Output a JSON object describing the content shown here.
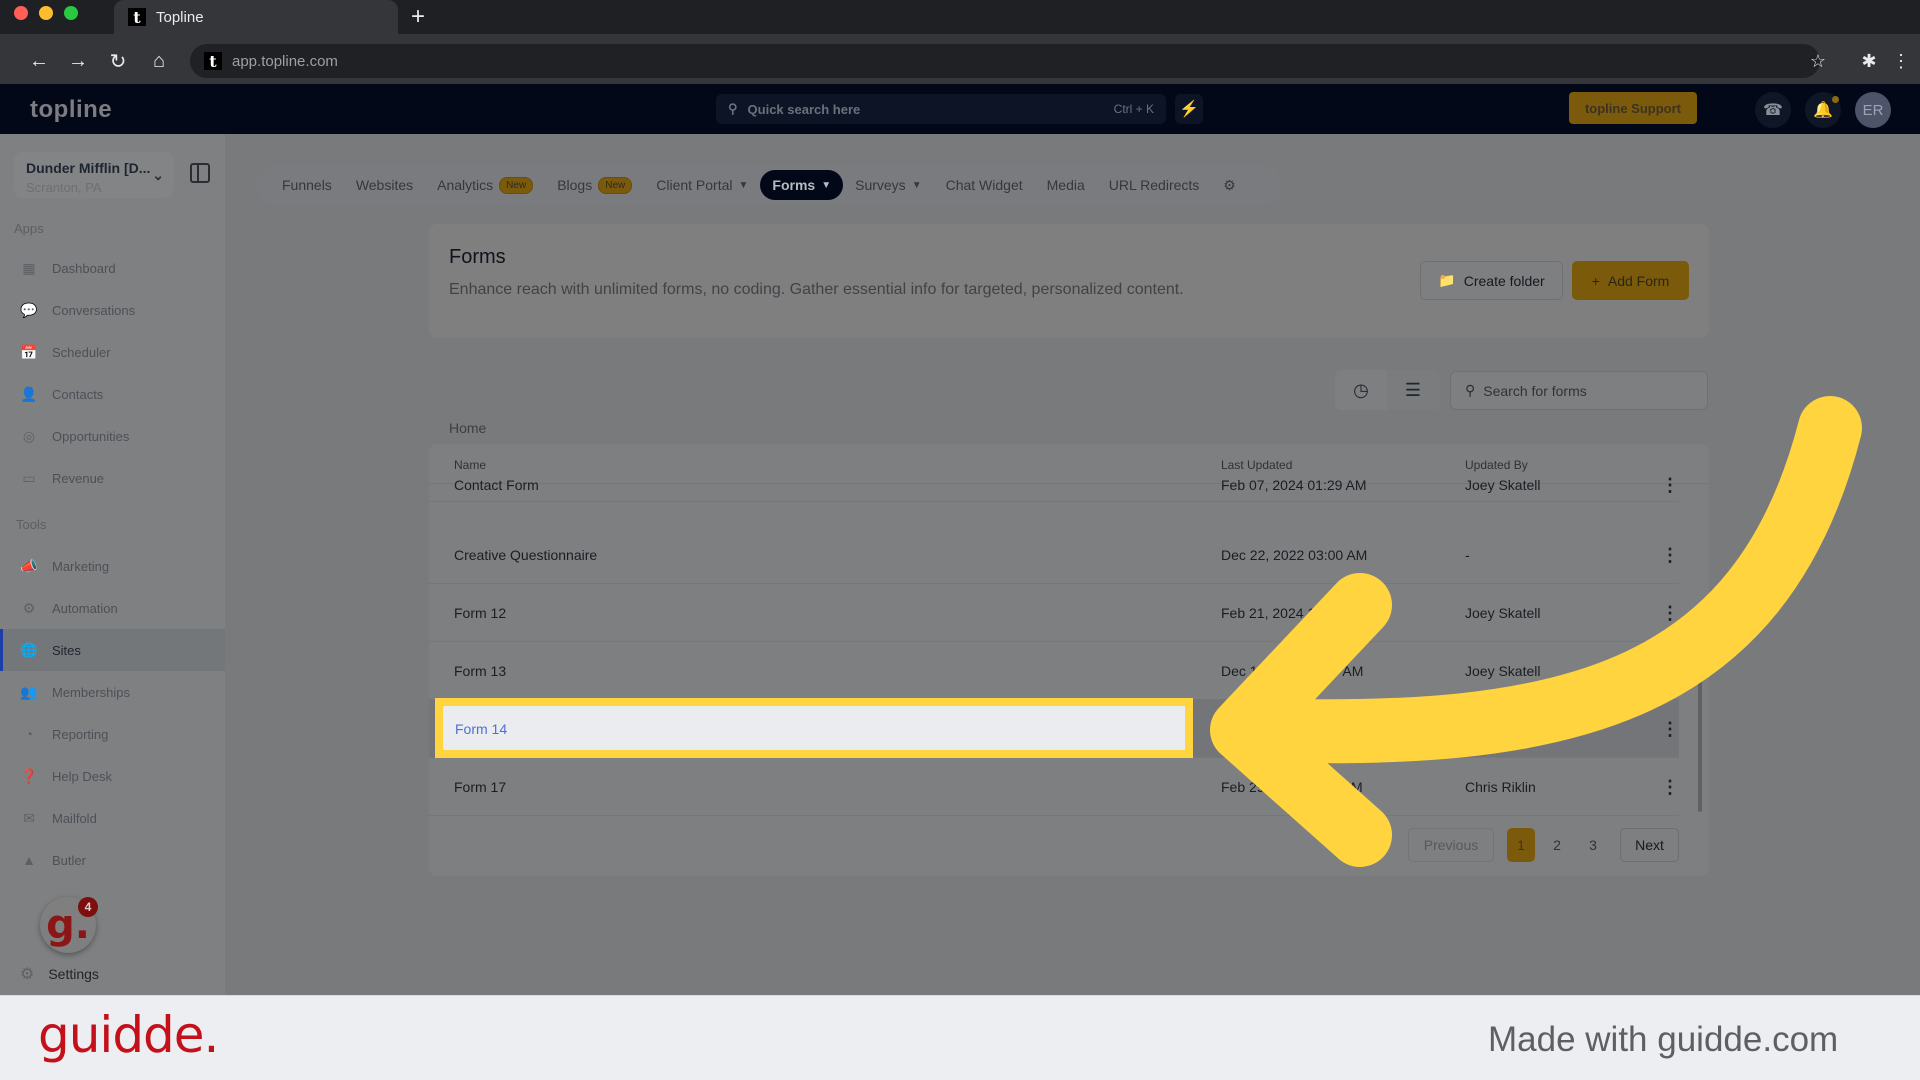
{
  "browser": {
    "tab_title": "Topline",
    "favicon_letter": "t",
    "url": "app.topline.com",
    "icons": [
      "back-icon",
      "forward-icon",
      "reload-icon",
      "home-icon",
      "star-icon",
      "extensions-icon",
      "menu-icon"
    ]
  },
  "header": {
    "logo": "topline",
    "quick_search_placeholder": "Quick search here",
    "quick_search_shortcut": "Ctrl + K",
    "support_label": "topline Support",
    "avatar_initials": "ER"
  },
  "sidebar": {
    "location_name": "Dunder Mifflin [D...",
    "location_sub": "Scranton, PA",
    "apps_heading": "Apps",
    "tools_heading": "Tools",
    "apps": [
      {
        "label": "Dashboard",
        "icon": "dashboard-icon"
      },
      {
        "label": "Conversations",
        "icon": "conversations-icon"
      },
      {
        "label": "Scheduler",
        "icon": "calendar-icon"
      },
      {
        "label": "Contacts",
        "icon": "contacts-icon"
      },
      {
        "label": "Opportunities",
        "icon": "opportunities-icon"
      },
      {
        "label": "Revenue",
        "icon": "revenue-icon"
      }
    ],
    "tools": [
      {
        "label": "Marketing",
        "icon": "megaphone-icon"
      },
      {
        "label": "Automation",
        "icon": "gears-icon"
      },
      {
        "label": "Sites",
        "icon": "globe-icon",
        "active": true
      },
      {
        "label": "Memberships",
        "icon": "memberships-icon"
      },
      {
        "label": "Reporting",
        "icon": "pie-chart-icon"
      },
      {
        "label": "Help Desk",
        "icon": "help-icon"
      },
      {
        "label": "Mailfold",
        "icon": "mailfold-icon"
      },
      {
        "label": "Butler",
        "icon": "bell-cloche-icon"
      }
    ],
    "guidde_badge_count": "4",
    "settings_label": "Settings"
  },
  "navtabs": [
    {
      "label": "Funnels"
    },
    {
      "label": "Websites"
    },
    {
      "label": "Analytics",
      "badge": "New"
    },
    {
      "label": "Blogs",
      "badge": "New"
    },
    {
      "label": "Client Portal",
      "dropdown": true
    },
    {
      "label": "Forms",
      "dropdown": true,
      "active": true
    },
    {
      "label": "Surveys",
      "dropdown": true
    },
    {
      "label": "Chat Widget"
    },
    {
      "label": "Media"
    },
    {
      "label": "URL Redirects"
    }
  ],
  "forms": {
    "title": "Forms",
    "description": "Enhance reach with unlimited forms, no coding. Gather essential info for targeted, personalized content.",
    "create_folder_label": "Create folder",
    "add_form_label": "Add Form",
    "search_placeholder": "Search for forms",
    "breadcrumb": "Home",
    "columns": [
      "Name",
      "Last Updated",
      "Updated By"
    ],
    "rows": [
      {
        "name": "Contact Form",
        "updated": "Feb 07, 2024 01:29 AM",
        "by": "Joey Skatell"
      },
      {
        "name": "Creative Questionnaire",
        "updated": "Dec 22, 2022 03:00 AM",
        "by": "-"
      },
      {
        "name": "Form 12",
        "updated": "Feb 21, 2024 1",
        "by": "Joey Skatell"
      },
      {
        "name": "Form 13",
        "updated": "Dec 14              :53 AM",
        "by": "Joey Skatell"
      },
      {
        "name": "Form 14",
        "updated": "",
        "by": ""
      },
      {
        "name": "Form 17",
        "updated": "Feb 29,              32 AM",
        "by": "Chris Riklin"
      }
    ],
    "highlighted_row": "Form 14",
    "pagination": {
      "previous": "Previous",
      "pages": [
        "1",
        "2",
        "3"
      ],
      "current": "1",
      "next": "Next"
    }
  },
  "footer": {
    "brand": "guidde.",
    "made_with": "Made with guidde.com"
  },
  "colors": {
    "accent_gold": "#7b5a0c",
    "highlight_yellow": "#ffd43f",
    "active_nav": "#020817",
    "link_blue": "#4a71d6",
    "guidde_red": "#c4101b"
  }
}
